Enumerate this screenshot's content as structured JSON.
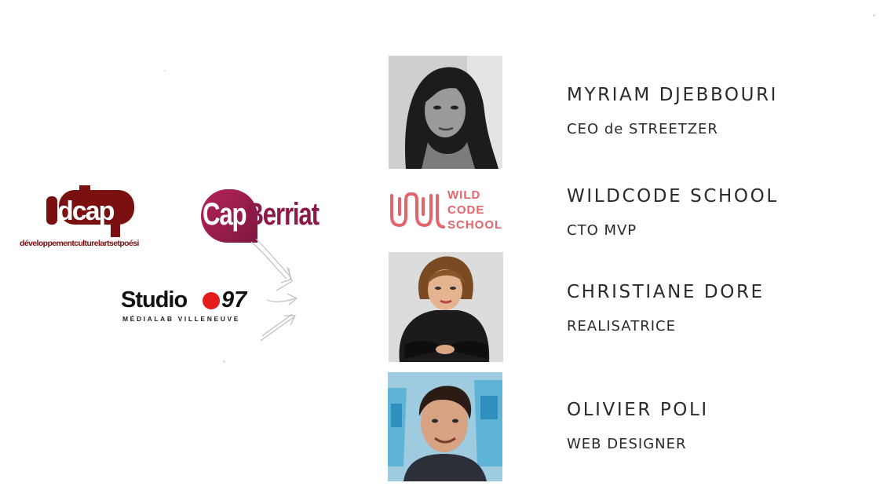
{
  "partners": {
    "dcap": {
      "mark": "dcap",
      "wordmark": "développementculturelartsetpoési"
    },
    "capberriat": {
      "part1": "Cap",
      "part2": "Berriat"
    },
    "studio97": {
      "name": "Studio",
      "number": "97",
      "subtitle": "MÉDIALAB VILLENEUVE"
    }
  },
  "team": [
    {
      "name": "MYRIAM DJEBBOURI",
      "role": "CEO de STREETZER"
    },
    {
      "name": "WILDCODE SCHOOL",
      "role": "CTO MVP",
      "logo_lines": [
        "WILD",
        "CODE",
        "SCHOOL"
      ]
    },
    {
      "name": "CHRISTIANE DORE",
      "role": "REALISATRICE"
    },
    {
      "name": "OLIVIER POLI",
      "role": "WEB DESIGNER"
    }
  ],
  "colors": {
    "dcap": "#7a1010",
    "capberriat": "#8c1a48",
    "studio_dot": "#e31b1b",
    "wildcode": "#e3646a",
    "text": "#2a2a2a"
  }
}
